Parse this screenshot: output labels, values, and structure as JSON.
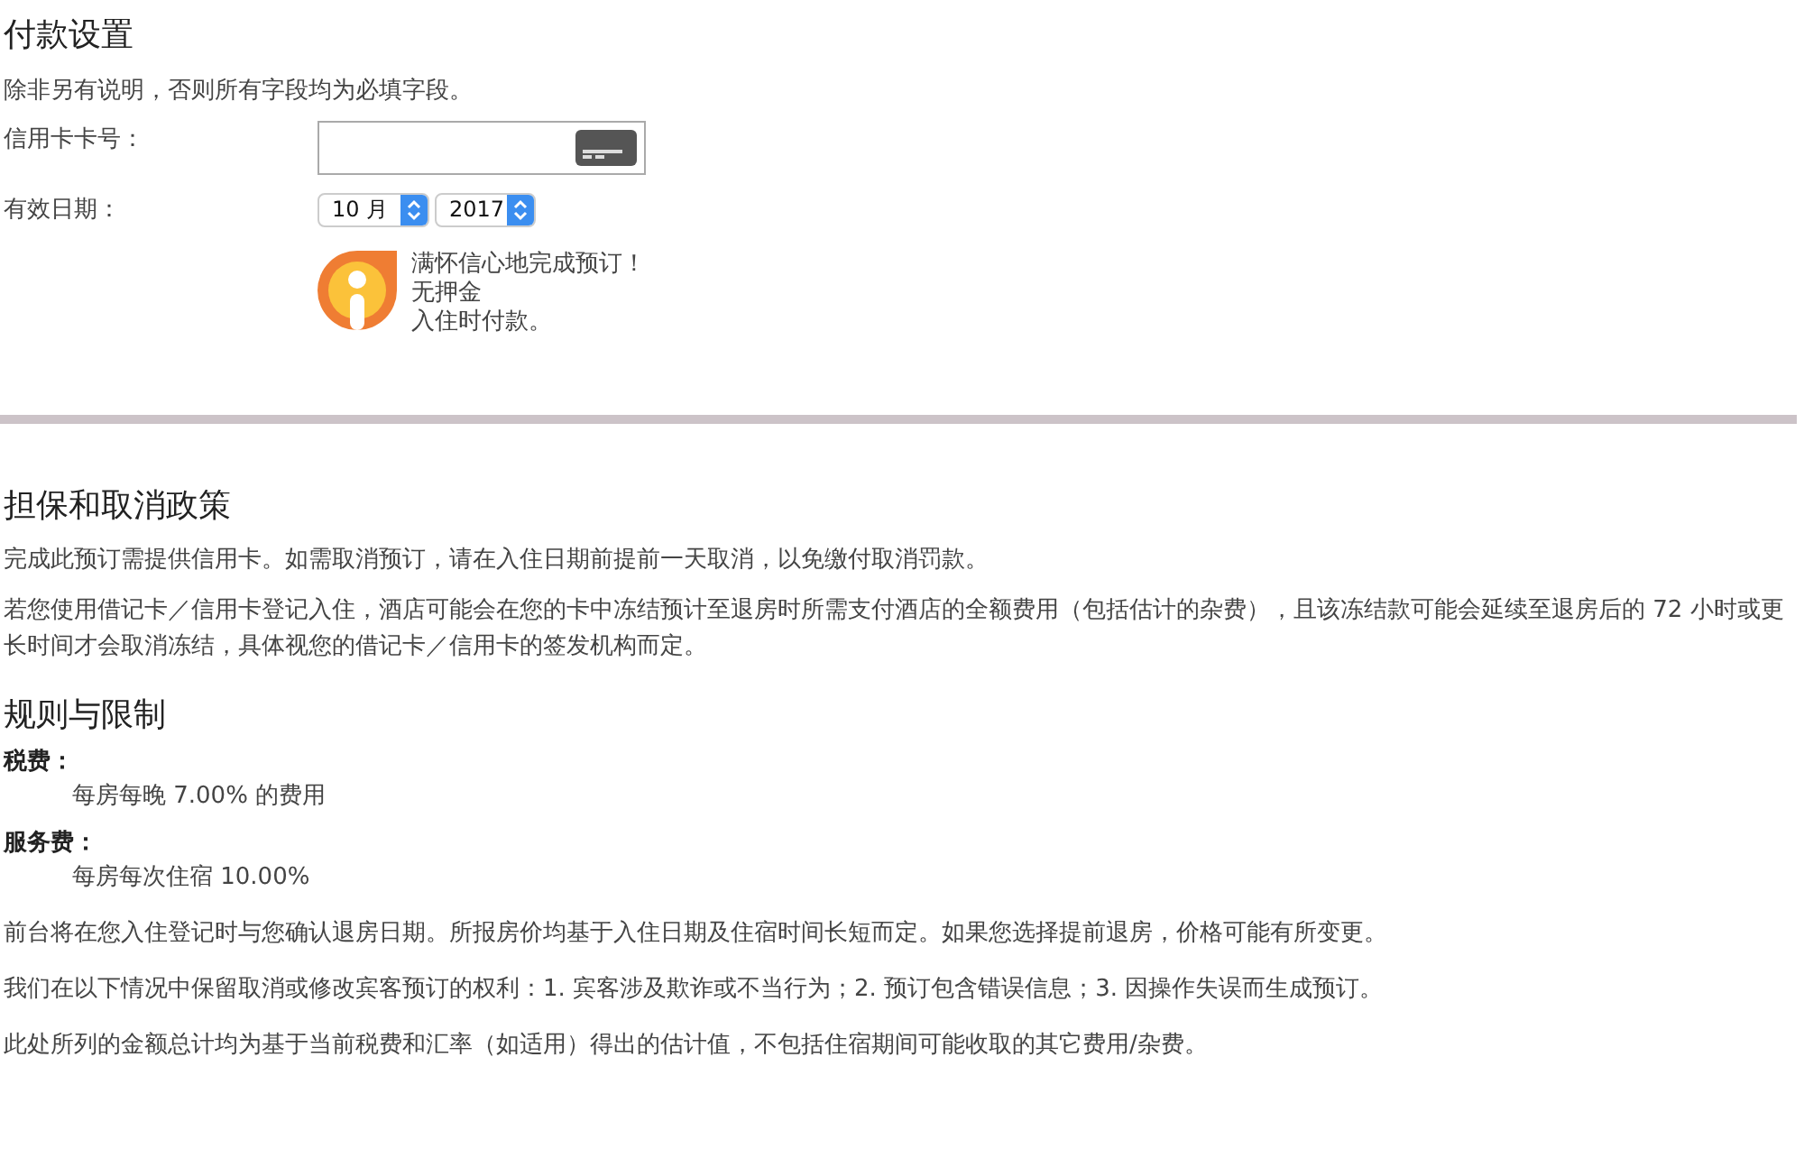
{
  "payment": {
    "title": "付款设置",
    "note": "除非另有说明，否则所有字段均为必填字段。",
    "card_number": {
      "label": "信用卡卡号："
    },
    "expiry": {
      "label": "有效日期：",
      "month": "10 月",
      "year": "2017"
    },
    "badge": {
      "lines": [
        "满怀信心地完成预订！",
        "无押金",
        "入住时付款。"
      ]
    }
  },
  "policy": {
    "title": "担保和取消政策",
    "paragraphs": [
      "完成此预订需提供信用卡。如需取消预订，请在入住日期前提前一天取消，以免缴付取消罚款。",
      "若您使用借记卡／信用卡登记入住，酒店可能会在您的卡中冻结预计至退房时所需支付酒店的全额费用（包括估计的杂费），且该冻结款可能会延续至退房后的 72 小时或更长时间才会取消冻结，具体视您的借记卡／信用卡的签发机构而定。"
    ]
  },
  "rules": {
    "title": "规则与限制",
    "fees": [
      {
        "label": "税费：",
        "value": "每房每晚 7.00% 的费用"
      },
      {
        "label": "服务费：",
        "value": "每房每次住宿 10.00%"
      }
    ],
    "paragraphs": [
      "前台将在您入住登记时与您确认退房日期。所报房价均基于入住日期及住宿时间长短而定。如果您选择提前退房，价格可能有所变更。",
      "我们在以下情况中保留取消或修改宾客预订的权利：1. 宾客涉及欺诈或不当行为；2. 预订包含错误信息；3. 因操作失误而生成预订。",
      "此处所列的金额总计均为基于当前税费和汇率（如适用）得出的估计值，不包括住宿期间可能收取的其它费用/杂费。"
    ]
  }
}
